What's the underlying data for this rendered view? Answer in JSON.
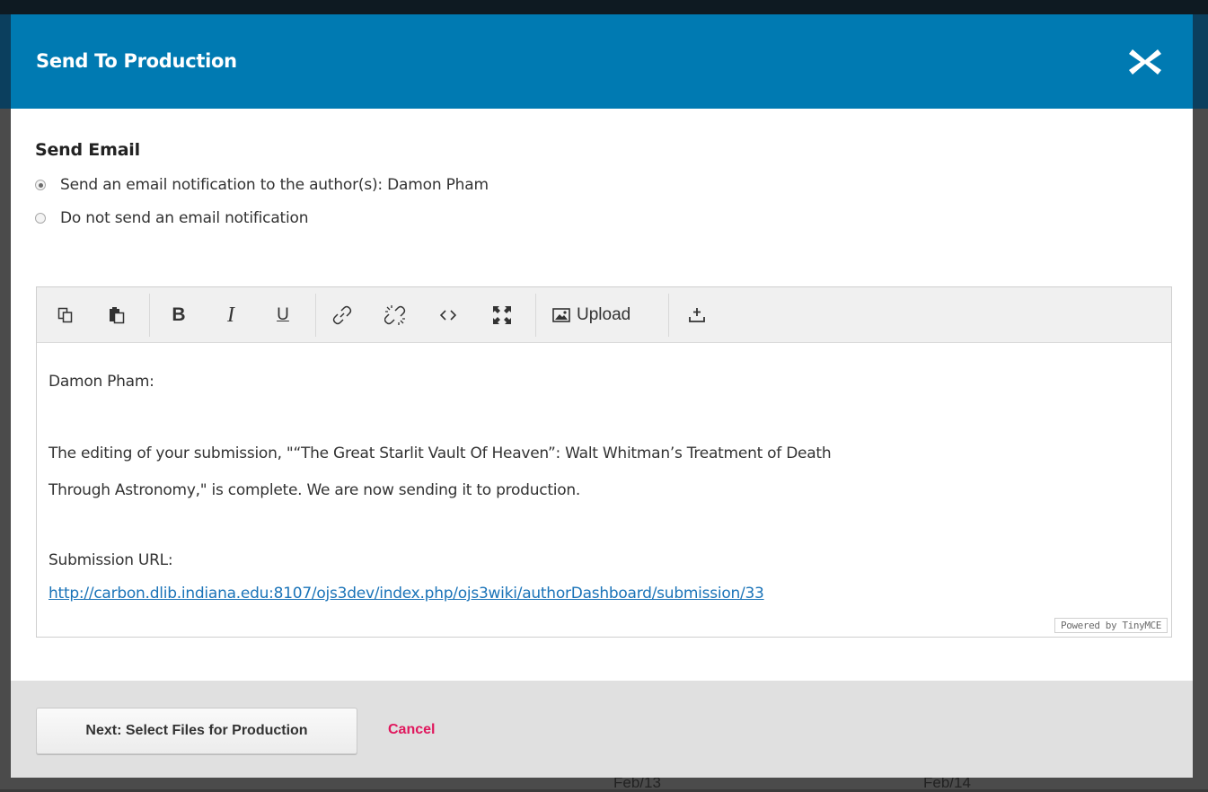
{
  "modal": {
    "title": "Send To Production",
    "close_icon": "close-icon"
  },
  "email_section": {
    "title": "Send Email",
    "options": [
      {
        "label": "Send an email notification to the author(s): Damon Pham",
        "checked": true
      },
      {
        "label": "Do not send an email notification",
        "checked": false
      }
    ]
  },
  "editor": {
    "toolbar": {
      "icons": [
        "copy-icon",
        "paste-icon",
        "bold-icon",
        "italic-icon",
        "underline-icon",
        "link-icon",
        "unlink-icon",
        "code-icon",
        "fullscreen-icon",
        "image-upload-icon",
        "insert-tag-icon"
      ],
      "upload_label": "Upload"
    },
    "content": {
      "greeting": "Damon Pham:",
      "body_line1": "The editing of your submission, \"“The Great Starlit Vault Of Heaven”: Walt Whitman’s Treatment of Death",
      "body_line2": "Through Astronomy,\" is complete. We are now sending it to production.",
      "url_label": "Submission URL:",
      "url": "http://carbon.dlib.indiana.edu:8107/ojs3dev/index.php/ojs3wiki/authorDashboard/submission/33"
    },
    "powered_by": "Powered by TinyMCE"
  },
  "footer": {
    "next_label": "Next: Select Files for Production",
    "cancel_label": "Cancel"
  },
  "background": {
    "date_left": "Feb/13",
    "date_right": "Feb/14"
  },
  "colors": {
    "header": "#007ab2",
    "cancel": "#e0175d",
    "link": "#1a73b8"
  }
}
